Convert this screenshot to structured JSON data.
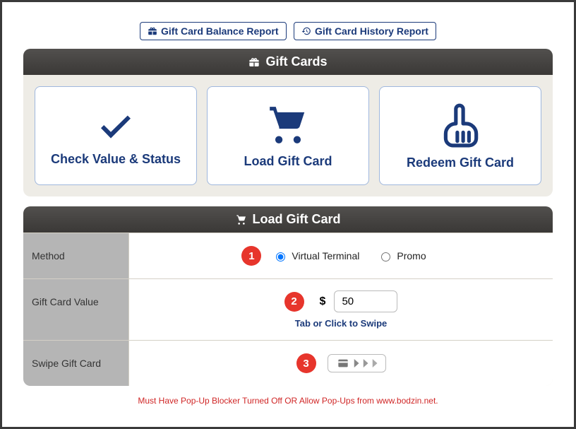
{
  "topLinks": {
    "balance": "Gift Card Balance Report",
    "history": "Gift Card History Report"
  },
  "mainPanelTitle": "Gift Cards",
  "cards": {
    "check": "Check Value & Status",
    "load": "Load Gift Card",
    "redeem": "Redeem Gift Card"
  },
  "loadPanelTitle": "Load Gift Card",
  "steps": {
    "one": "1",
    "two": "2",
    "three": "3"
  },
  "form": {
    "methodLabel": "Method",
    "virtual": "Virtual Terminal",
    "promo": "Promo",
    "valueLabel": "Gift Card Value",
    "currency": "$",
    "amount": "50",
    "hint": "Tab or Click to Swipe",
    "swipeLabel": "Swipe Gift Card"
  },
  "footer": "Must Have Pop-Up Blocker Turned Off OR Allow Pop-Ups from www.bodzin.net."
}
